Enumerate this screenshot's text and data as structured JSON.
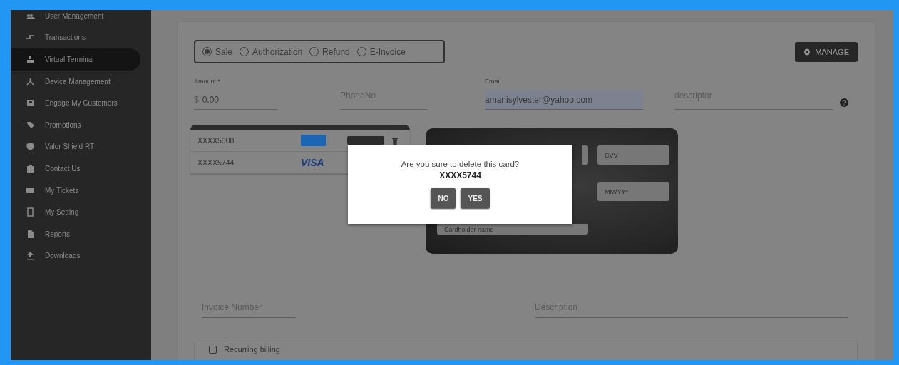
{
  "sidebar": {
    "items": [
      {
        "label": "User Management",
        "selected": false
      },
      {
        "label": "Transactions",
        "selected": false
      },
      {
        "label": "Virtual Terminal",
        "selected": true
      },
      {
        "label": "Device Management",
        "selected": false
      },
      {
        "label": "Engage My Customers",
        "selected": false
      },
      {
        "label": "Promotions",
        "selected": false
      },
      {
        "label": "Valor Shield RT",
        "selected": false
      },
      {
        "label": "Contact Us",
        "selected": false
      },
      {
        "label": "My Tickets",
        "selected": false
      },
      {
        "label": "My Setting",
        "selected": false
      },
      {
        "label": "Reports",
        "selected": false
      },
      {
        "label": "Downloads",
        "selected": false
      }
    ]
  },
  "transaction_types": [
    {
      "label": "Sale",
      "selected": true
    },
    {
      "label": "Authorization",
      "selected": false
    },
    {
      "label": "Refund",
      "selected": false
    },
    {
      "label": "E-Invoice",
      "selected": false
    }
  ],
  "manage_button": {
    "label": "MANAGE"
  },
  "fields": [
    {
      "label": "Amount *",
      "prefix": "$",
      "value": "0.00",
      "autofilled": false
    },
    {
      "placeholder": "PhoneNo"
    },
    {
      "label": "Email",
      "value": "amanisylvester@yahoo.com",
      "autofilled": true
    },
    {
      "placeholder": "descriptor",
      "help": true
    }
  ],
  "saved_cards": [
    {
      "number": "XXXX5008",
      "kind": "amex"
    },
    {
      "number": "XXXX5744",
      "kind": "visa",
      "brand_text": "VISA"
    }
  ],
  "card_form": {
    "fields": [
      {
        "placeholder": "CVV"
      },
      {
        "placeholder": "MM/YY*"
      },
      {
        "placeholder": "Cardholder name"
      }
    ]
  },
  "invoice_fields": [
    {
      "placeholder": "Invoice Number"
    },
    {
      "placeholder": "Description"
    }
  ],
  "recurring_billing": {
    "label": "Recurring billing",
    "checked": false
  },
  "dialog": {
    "message": "Are you sure to delete this card?",
    "card": "XXXX5744",
    "buttons": [
      "NO",
      "YES"
    ]
  }
}
